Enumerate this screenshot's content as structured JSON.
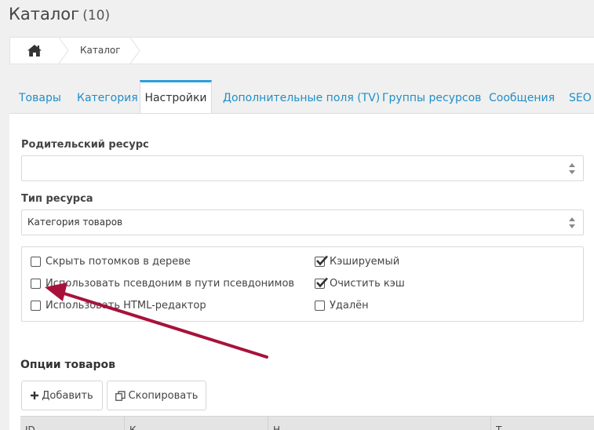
{
  "header": {
    "title": "Каталог",
    "count": "(10)"
  },
  "breadcrumb": {
    "home_icon": "home-icon",
    "item": "Каталог"
  },
  "tabs": [
    {
      "label": "Товары"
    },
    {
      "label": "Категория"
    },
    {
      "label": "Настройки",
      "active": true
    },
    {
      "label": "Дополнительные поля (TV)"
    },
    {
      "label": "Группы ресурсов"
    },
    {
      "label": "Сообщения"
    },
    {
      "label": "SEO"
    }
  ],
  "form": {
    "parent_label": "Родительский ресурс",
    "parent_value": "",
    "type_label": "Тип ресурса",
    "type_value": "Категория товаров"
  },
  "checkboxes": [
    {
      "label": "Скрыть потомков в дереве",
      "checked": false
    },
    {
      "label": "Использовать псевдоним в пути псевдонимов",
      "checked": false
    },
    {
      "label": "Использовать HTML-редактор",
      "checked": false
    },
    {
      "label": "Кэшируемый",
      "checked": true
    },
    {
      "label": "Очистить кэш",
      "checked": true
    },
    {
      "label": "Удалён",
      "checked": false
    }
  ],
  "options": {
    "title": "Опции товаров",
    "add_label": "Добавить",
    "copy_label": "Скопировать"
  },
  "grid": {
    "columns": [
      "ID",
      "К",
      "Н",
      "Т"
    ]
  },
  "colors": {
    "link": "#1f8fc7",
    "tab_active_border": "#2ca0d8",
    "annotation_arrow": "#a8123a"
  }
}
